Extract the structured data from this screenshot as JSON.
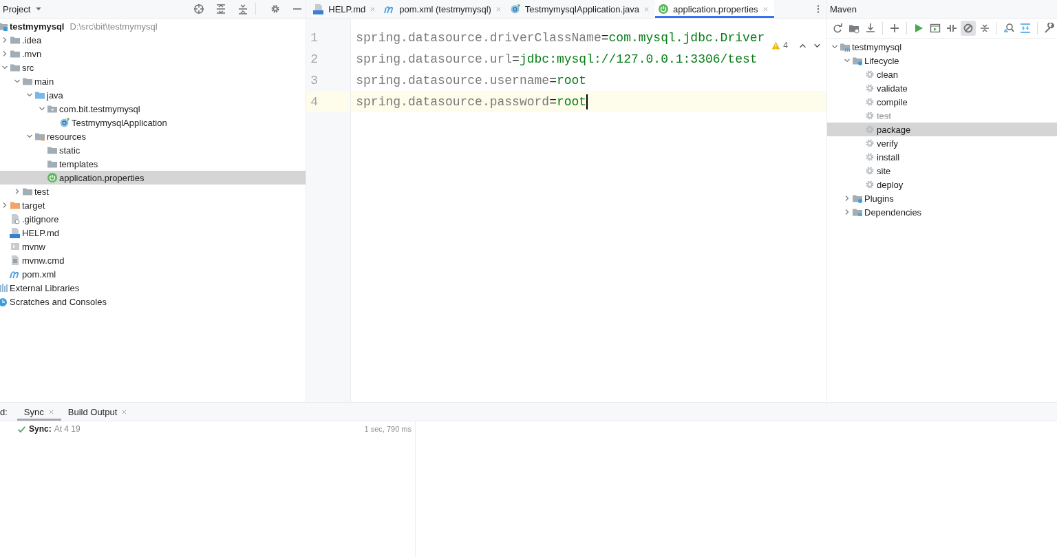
{
  "project_panel": {
    "title": "Project",
    "tree": [
      {
        "label": "testmymysql",
        "path": "D:\\src\\bit\\testmymysql",
        "kind": "module",
        "selected": false,
        "children": [
          {
            "label": ".idea",
            "kind": "folder",
            "expanded": false,
            "selected": false
          },
          {
            "label": ".mvn",
            "kind": "folder",
            "expanded": false,
            "selected": false
          },
          {
            "label": "src",
            "kind": "folder",
            "expanded": true,
            "selected": false,
            "children": [
              {
                "label": "main",
                "kind": "folder",
                "expanded": true,
                "selected": false,
                "children": [
                  {
                    "label": "java",
                    "kind": "folder-source",
                    "expanded": true,
                    "selected": false,
                    "children": [
                      {
                        "label": "com.bit.testmymysql",
                        "kind": "package",
                        "expanded": true,
                        "selected": false,
                        "children": [
                          {
                            "label": "TestmymysqlApplication",
                            "kind": "spring-class",
                            "selected": false
                          }
                        ]
                      }
                    ]
                  },
                  {
                    "label": "resources",
                    "kind": "folder-resources",
                    "expanded": true,
                    "selected": false,
                    "children": [
                      {
                        "label": "static",
                        "kind": "folder",
                        "selected": false
                      },
                      {
                        "label": "templates",
                        "kind": "folder",
                        "selected": false
                      },
                      {
                        "label": "application.properties",
                        "kind": "spring-file",
                        "selected": true
                      }
                    ]
                  }
                ]
              },
              {
                "label": "test",
                "kind": "folder",
                "expanded": false,
                "selected": false
              }
            ]
          },
          {
            "label": "target",
            "kind": "folder-excluded",
            "expanded": false,
            "selected": false
          },
          {
            "label": ".gitignore",
            "kind": "ignore-file",
            "selected": false
          },
          {
            "label": "HELP.md",
            "kind": "markdown",
            "selected": false
          },
          {
            "label": "mvnw",
            "kind": "script",
            "selected": false
          },
          {
            "label": "mvnw.cmd",
            "kind": "text-file",
            "selected": false
          },
          {
            "label": "pom.xml",
            "kind": "maven",
            "selected": false
          }
        ]
      },
      {
        "label": "External Libraries",
        "kind": "libraries",
        "selected": false
      },
      {
        "label": "Scratches and Consoles",
        "kind": "scratches",
        "selected": false
      }
    ]
  },
  "editor": {
    "tabs": [
      {
        "label": "HELP.md",
        "kind": "markdown",
        "selected": false
      },
      {
        "label": "pom.xml (testmymysql)",
        "kind": "maven",
        "selected": false
      },
      {
        "label": "TestmymysqlApplication.java",
        "kind": "spring-class",
        "selected": false
      },
      {
        "label": "application.properties",
        "kind": "spring-file",
        "selected": true
      }
    ],
    "warnings": "4",
    "lines": [
      {
        "number": "1",
        "key": "spring.datasource.driverClassName",
        "sep": "=",
        "value": "com.mysql.jdbc.Driver",
        "current": false
      },
      {
        "number": "2",
        "key": "spring.datasource.url",
        "sep": "=",
        "value": "jdbc:mysql://127.0.0.1:3306/test",
        "current": false
      },
      {
        "number": "3",
        "key": "spring.datasource.username",
        "sep": "=",
        "value": "root",
        "current": false
      },
      {
        "number": "4",
        "key": "spring.datasource.password",
        "sep": "=",
        "value": "root",
        "current": true
      }
    ]
  },
  "maven_panel": {
    "title": "Maven",
    "toolbar": [
      {
        "kind": "reload",
        "pressed": false
      },
      {
        "kind": "add-folder",
        "pressed": false
      },
      {
        "kind": "download",
        "pressed": false
      },
      {
        "kind": "plus",
        "pressed": false
      },
      {
        "kind": "run",
        "pressed": false
      },
      {
        "kind": "run-config",
        "pressed": false
      },
      {
        "kind": "offline",
        "pressed": false
      },
      {
        "kind": "skip",
        "pressed": true
      },
      {
        "kind": "collapse",
        "pressed": false
      },
      {
        "kind": "analyze",
        "pressed": false
      },
      {
        "kind": "diagram",
        "pressed": false
      },
      {
        "kind": "wrench",
        "pressed": false
      }
    ],
    "tree": [
      {
        "label": "testmymysql",
        "kind": "maven-module",
        "expanded": true,
        "selected": false,
        "children": [
          {
            "label": "Lifecycle",
            "kind": "folder-gear",
            "expanded": true,
            "selected": false,
            "children": [
              {
                "label": "clean",
                "kind": "gear",
                "selected": false,
                "skipped": false
              },
              {
                "label": "validate",
                "kind": "gear",
                "selected": false,
                "skipped": false
              },
              {
                "label": "compile",
                "kind": "gear",
                "selected": false,
                "skipped": false
              },
              {
                "label": "test",
                "kind": "gear",
                "selected": false,
                "skipped": true
              },
              {
                "label": "package",
                "kind": "gear",
                "selected": true,
                "skipped": false
              },
              {
                "label": "verify",
                "kind": "gear",
                "selected": false,
                "skipped": false
              },
              {
                "label": "install",
                "kind": "gear",
                "selected": false,
                "skipped": false
              },
              {
                "label": "site",
                "kind": "gear",
                "selected": false,
                "skipped": false
              },
              {
                "label": "deploy",
                "kind": "gear",
                "selected": false,
                "skipped": false
              }
            ]
          },
          {
            "label": "Plugins",
            "kind": "folder-gear",
            "expanded": false,
            "selected": false
          },
          {
            "label": "Dependencies",
            "kind": "libraries-folder",
            "expanded": false,
            "selected": false
          }
        ]
      }
    ]
  },
  "build_panel": {
    "label": "d:",
    "tabs": [
      {
        "label": "Sync",
        "selected": true
      },
      {
        "label": "Build Output",
        "selected": false
      }
    ],
    "entry": {
      "title": "Sync:",
      "detail": "At 4 19",
      "duration": "1 sec, 790 ms"
    }
  }
}
